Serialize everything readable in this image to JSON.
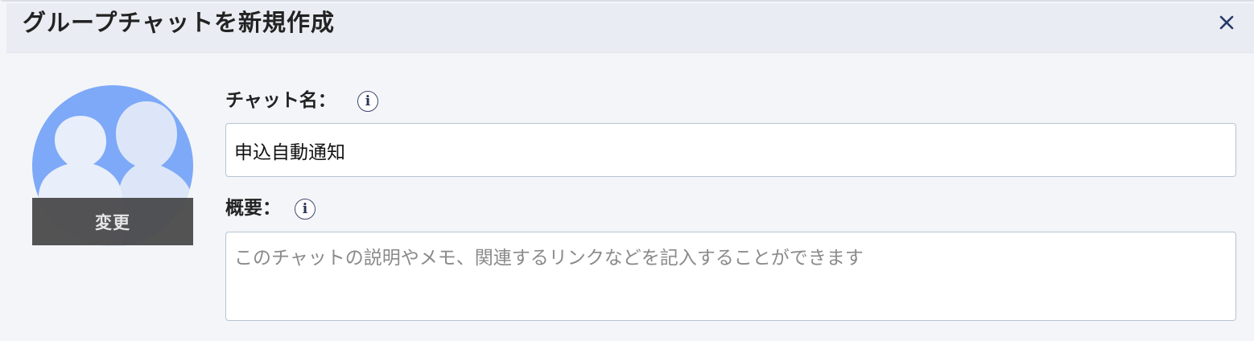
{
  "header": {
    "title": "グループチャットを新規作成",
    "close_icon": "close-icon"
  },
  "avatar": {
    "change_label": "変更",
    "image": "group-avatar-silhouettes"
  },
  "form": {
    "chat_name": {
      "label": "チャット名：",
      "info_icon": "info-icon",
      "value": "申込自動通知"
    },
    "summary": {
      "label": "概要：",
      "info_icon": "info-icon",
      "value": "",
      "placeholder": "このチャットの説明やメモ、関連するリンクなどを記入することができます"
    }
  },
  "colors": {
    "header_bg": "#e9ecf2",
    "body_bg": "#f3f5f8",
    "avatar_bg": "#7da9f8",
    "input_border": "#b7c4d2"
  }
}
